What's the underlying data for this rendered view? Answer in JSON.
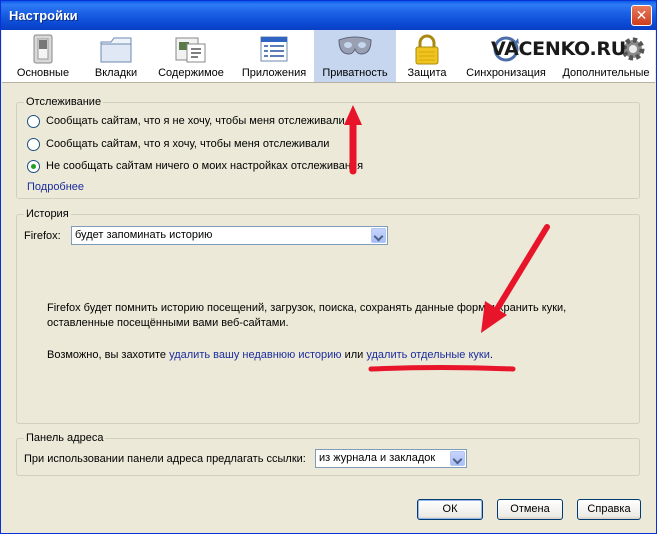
{
  "window": {
    "title": "Настройки"
  },
  "watermark": "VACENKO.RU",
  "toolbar": {
    "items": [
      {
        "label": "Основные",
        "icon": "switch-icon"
      },
      {
        "label": "Вкладки",
        "icon": "tabs-folder-icon"
      },
      {
        "label": "Содержимое",
        "icon": "content-icon"
      },
      {
        "label": "Приложения",
        "icon": "applications-icon"
      },
      {
        "label": "Приватность",
        "icon": "mask-icon",
        "selected": true
      },
      {
        "label": "Защита",
        "icon": "lock-icon"
      },
      {
        "label": "Синхронизация",
        "icon": "sync-icon"
      },
      {
        "label": "Дополнительные",
        "icon": "gear-icon"
      }
    ]
  },
  "tracking": {
    "legend": "Отслеживание",
    "options": [
      "Сообщать сайтам, что я не хочу, чтобы меня отслеживали",
      "Сообщать сайтам, что я хочу, чтобы меня отслеживали",
      "Не сообщать сайтам ничего о моих настройках отслеживания"
    ],
    "selected_index": 2,
    "more_link": "Подробнее"
  },
  "history": {
    "legend": "История",
    "firefox_label": "Firefox:",
    "mode_value": "будет запоминать историю",
    "description_line1": "Firefox будет помнить историю посещений, загрузок, поиска, сохранять данные форм и хранить куки,",
    "description_line2": "оставленные посещёнными вами веб-сайтами.",
    "maybe_prefix": "Возможно, вы захотите",
    "clear_recent_link": "удалить вашу недавнюю историю",
    "or_text": "или",
    "remove_cookies_link": "удалить отдельные куки",
    "period": "."
  },
  "address_bar": {
    "legend": "Панель адреса",
    "suggest_label": "При использовании панели адреса предлагать ссылки:",
    "suggest_value": "из журнала и закладок"
  },
  "buttons": {
    "ok": "ОК",
    "cancel": "Отмена",
    "help": "Справка"
  },
  "colors": {
    "title_bar": "#0a5ae8",
    "selected_tab": "#c6d6ee",
    "annotation": "#e8142a",
    "link": "#1b2d9e"
  }
}
